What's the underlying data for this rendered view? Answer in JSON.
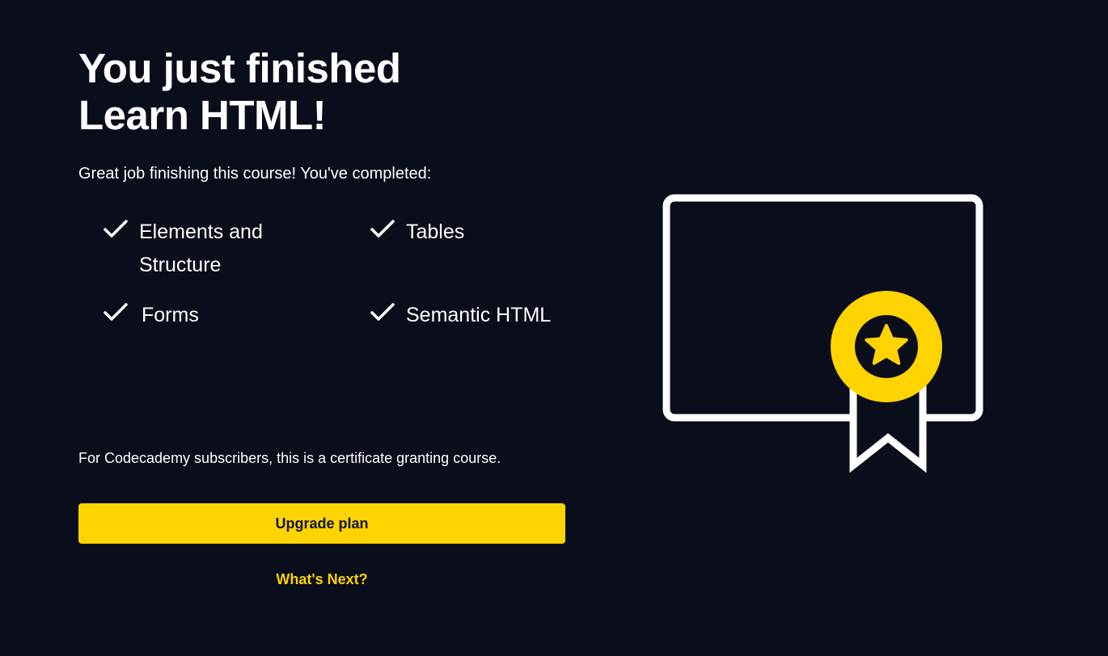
{
  "heading": {
    "line1": "You just finished",
    "line2": "Learn HTML!"
  },
  "subtitle": "Great job finishing this course! You've completed:",
  "topics": [
    {
      "label": "Elements and Structure",
      "icon": "check-icon"
    },
    {
      "label": "Tables",
      "icon": "check-icon"
    },
    {
      "label": "Forms",
      "icon": "check-icon"
    },
    {
      "label": "Semantic HTML",
      "icon": "check-icon"
    }
  ],
  "note": "For Codecademy subscribers, this is a certificate granting course.",
  "actions": {
    "upgrade_label": "Upgrade plan",
    "next_label": "What's Next?"
  },
  "illustration": {
    "icon": "certificate-icon",
    "badge_icon": "star-badge-icon"
  },
  "colors": {
    "background": "#0a0d1a",
    "accent": "#ffd300",
    "text": "#ffffff",
    "button_text": "#10162f"
  }
}
